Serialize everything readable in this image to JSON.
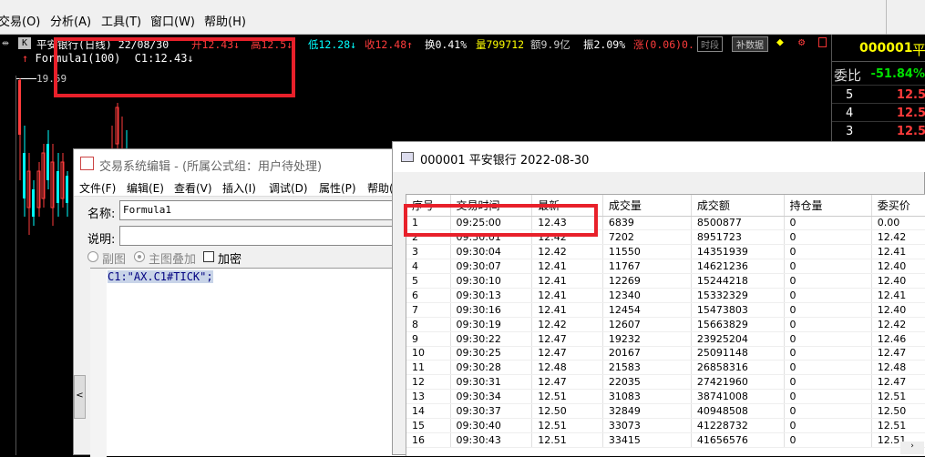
{
  "menubar": {
    "items": [
      "交易(O)",
      "分析(A)",
      "工具(T)",
      "窗口(W)",
      "帮助(H)"
    ]
  },
  "infobar": {
    "k": "K",
    "name": "平安银行(日线) 22/08/30",
    "open": "开12.43↓",
    "high": "高12.5↓",
    "low": "低12.28↓",
    "close": "收12.48↑",
    "turnover": "换0.41%",
    "volume": "量799712",
    "amount": "额9.9亿",
    "amplitude": "振2.09%",
    "change": "涨(0.06)0.",
    "tab_time": "时段",
    "tab_fill": "补数据"
  },
  "formula_row": {
    "label": "Formula1(100)",
    "value": "C1:12.43↓"
  },
  "axis_label": "19.59",
  "right_panel": {
    "code": "000001",
    "name": "平",
    "weibi_label": "委比",
    "weibi_value": "-51.84%",
    "levels": [
      {
        "n": "5",
        "p": "12.5"
      },
      {
        "n": "4",
        "p": "12.5"
      },
      {
        "n": "3",
        "p": "12.5"
      }
    ]
  },
  "formula_editor": {
    "title": "交易系统编辑 - (所属公式组：用户待处理)",
    "menu": [
      "文件(F)",
      "编辑(E)",
      "查看(V)",
      "插入(I)",
      "调试(D)",
      "属性(P)",
      "帮助("
    ],
    "name_label": "名称:",
    "name_value": "Formula1",
    "desc_label": "说明:",
    "radio_sub": "副图",
    "radio_main": "主图叠加",
    "checkbox_encrypt": "加密",
    "code": "C1:\"AX.C1#TICK\";"
  },
  "tick_window": {
    "title": "000001 平安银行 2022-08-30",
    "columns": [
      "序号",
      "交易时间",
      "最新",
      "成交量",
      "成交额",
      "持仓量",
      "委买价"
    ],
    "rows": [
      [
        "1",
        "09:25:00",
        "12.43",
        "6839",
        "8500877",
        "0",
        "0.00"
      ],
      [
        "2",
        "09:30:01",
        "12.42",
        "7202",
        "8951723",
        "0",
        "12.42"
      ],
      [
        "3",
        "09:30:04",
        "12.42",
        "11550",
        "14351939",
        "0",
        "12.41"
      ],
      [
        "4",
        "09:30:07",
        "12.41",
        "11767",
        "14621236",
        "0",
        "12.40"
      ],
      [
        "5",
        "09:30:10",
        "12.41",
        "12269",
        "15244218",
        "0",
        "12.40"
      ],
      [
        "6",
        "09:30:13",
        "12.41",
        "12340",
        "15332329",
        "0",
        "12.41"
      ],
      [
        "7",
        "09:30:16",
        "12.41",
        "12454",
        "15473803",
        "0",
        "12.40"
      ],
      [
        "8",
        "09:30:19",
        "12.42",
        "12607",
        "15663829",
        "0",
        "12.42"
      ],
      [
        "9",
        "09:30:22",
        "12.47",
        "19232",
        "23925204",
        "0",
        "12.46"
      ],
      [
        "10",
        "09:30:25",
        "12.47",
        "20167",
        "25091148",
        "0",
        "12.47"
      ],
      [
        "11",
        "09:30:28",
        "12.48",
        "21583",
        "26858316",
        "0",
        "12.48"
      ],
      [
        "12",
        "09:30:31",
        "12.47",
        "22035",
        "27421960",
        "0",
        "12.47"
      ],
      [
        "13",
        "09:30:34",
        "12.51",
        "31083",
        "38741008",
        "0",
        "12.51"
      ],
      [
        "14",
        "09:30:37",
        "12.50",
        "32849",
        "40948508",
        "0",
        "12.50"
      ],
      [
        "15",
        "09:30:40",
        "12.51",
        "33073",
        "41228732",
        "0",
        "12.51"
      ],
      [
        "16",
        "09:30:43",
        "12.51",
        "33415",
        "41656576",
        "0",
        "12.51"
      ]
    ]
  }
}
